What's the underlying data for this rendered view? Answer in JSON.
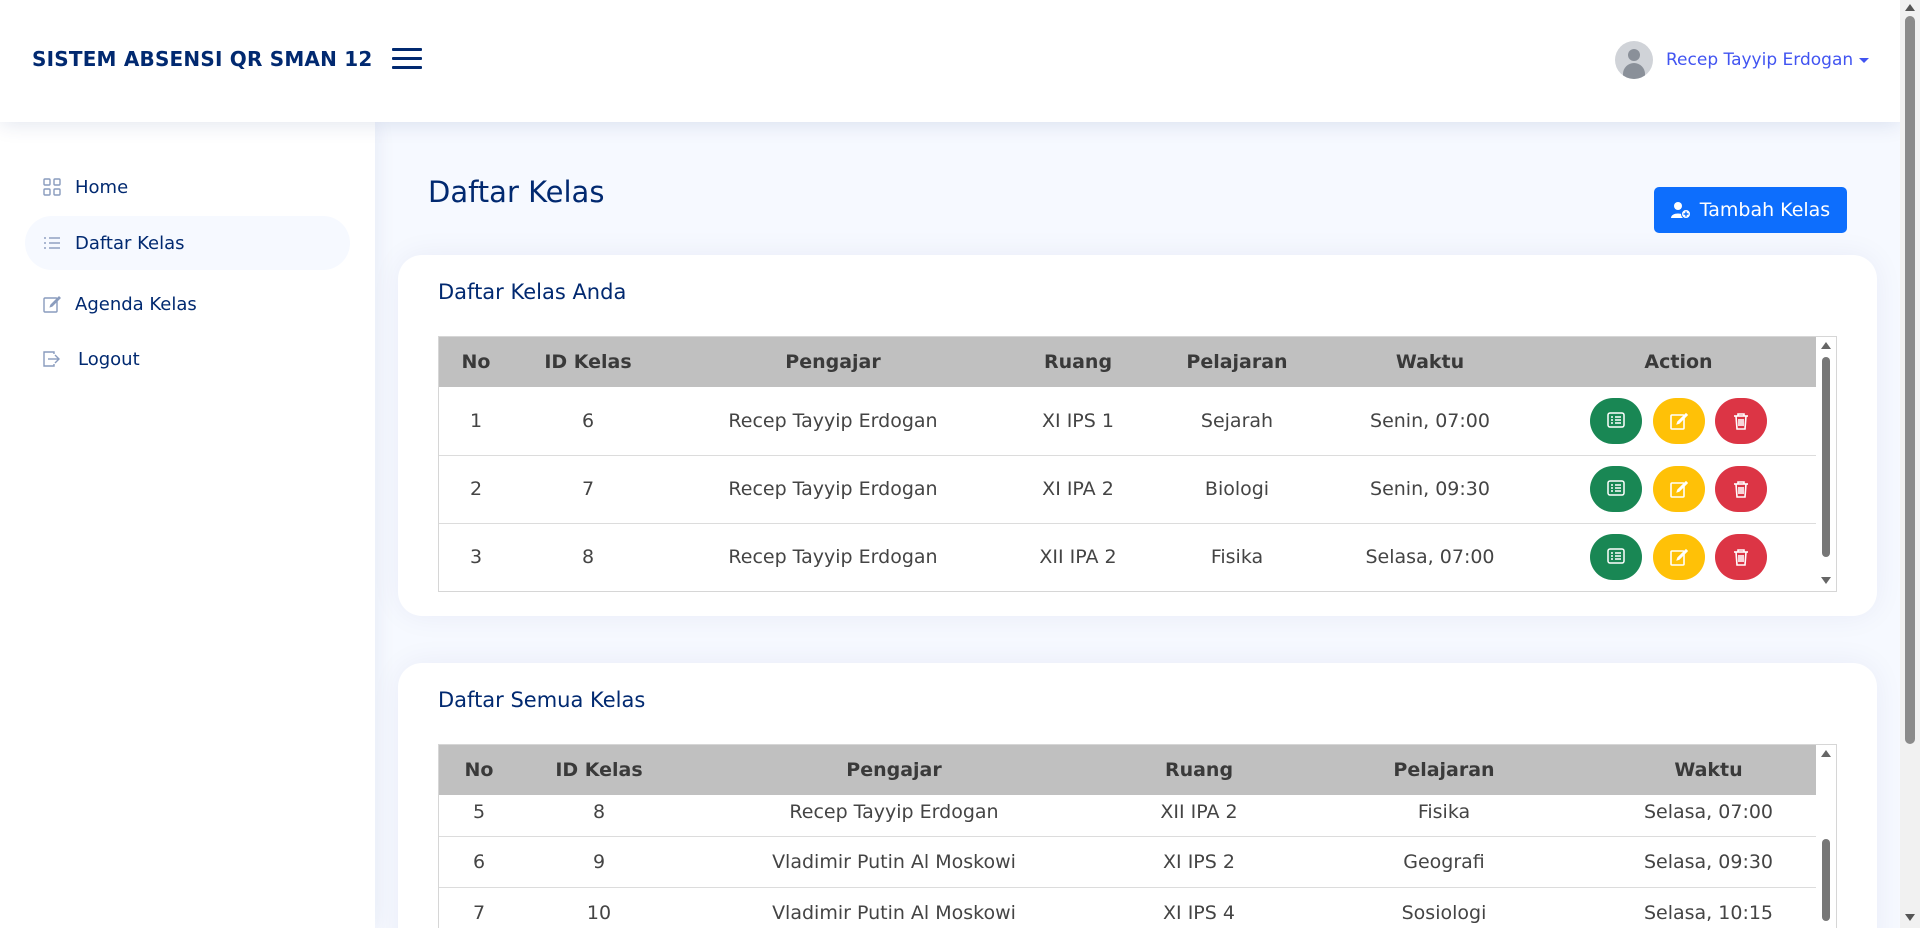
{
  "header": {
    "app_title": "SISTEM ABSENSI QR SMAN 12",
    "user_name": "Recep Tayyip Erdogan"
  },
  "sidebar": {
    "items": [
      {
        "label": "Home",
        "icon": "grid-icon",
        "active": false
      },
      {
        "label": "Daftar Kelas",
        "icon": "list-icon",
        "active": true
      },
      {
        "label": "Agenda Kelas",
        "icon": "edit-icon",
        "active": false
      },
      {
        "label": "Logout",
        "icon": "logout-icon",
        "active": false
      }
    ]
  },
  "main": {
    "page_title": "Daftar Kelas",
    "add_button_label": "Tambah Kelas"
  },
  "my_classes": {
    "title": "Daftar Kelas Anda",
    "columns": [
      "No",
      "ID Kelas",
      "Pengajar",
      "Ruang",
      "Pelajaran",
      "Waktu",
      "Action"
    ],
    "rows": [
      {
        "no": "1",
        "id": "6",
        "teacher": "Recep Tayyip Erdogan",
        "room": "XI IPS 1",
        "subject": "Sejarah",
        "time": "Senin, 07:00"
      },
      {
        "no": "2",
        "id": "7",
        "teacher": "Recep Tayyip Erdogan",
        "room": "XI IPA 2",
        "subject": "Biologi",
        "time": "Senin, 09:30"
      },
      {
        "no": "3",
        "id": "8",
        "teacher": "Recep Tayyip Erdogan",
        "room": "XII IPA 2",
        "subject": "Fisika",
        "time": "Selasa, 07:00"
      }
    ]
  },
  "all_classes": {
    "title": "Daftar Semua Kelas",
    "columns": [
      "No",
      "ID Kelas",
      "Pengajar",
      "Ruang",
      "Pelajaran",
      "Waktu"
    ],
    "rows": [
      {
        "no": "5",
        "id": "8",
        "teacher": "Recep Tayyip Erdogan",
        "room": "XII IPA 2",
        "subject": "Fisika",
        "time": "Selasa, 07:00"
      },
      {
        "no": "6",
        "id": "9",
        "teacher": "Vladimir Putin Al Moskowi",
        "room": "XI IPS 2",
        "subject": "Geografi",
        "time": "Selasa, 09:30"
      },
      {
        "no": "7",
        "id": "10",
        "teacher": "Vladimir Putin Al Moskowi",
        "room": "XI IPS 4",
        "subject": "Sosiologi",
        "time": "Selasa, 10:15"
      }
    ]
  },
  "colors": {
    "brand": "#012970",
    "accent": "#4154f1",
    "primary_button": "#0d6efd",
    "view_button": "#198754",
    "edit_button": "#ffc107",
    "delete_button": "#dc3545",
    "table_header": "#c0c0c0"
  }
}
